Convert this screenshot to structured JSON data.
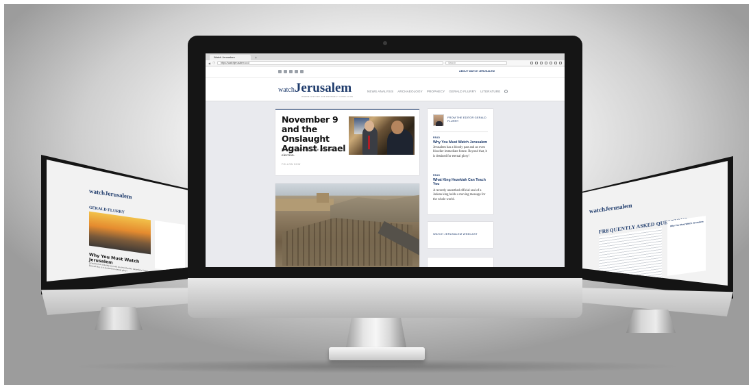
{
  "browser": {
    "tab_title": "Watch Jerusalem",
    "new_tab": "+",
    "url": "https://watchjerusalem.co.il",
    "search_placeholder": "Search"
  },
  "site": {
    "top_link": "ABOUT WATCH JERUSALEM",
    "logo_watch": "watch",
    "logo_jerusalem": "Jerusalem",
    "tagline": "WHERE HISTORY AND PROPHECY COME ALIVE",
    "nav": [
      "NEWS ANALYSIS",
      "ARCHAEOLOGY",
      "PROPHECY",
      "GERALD FLURRY",
      "LITERATURE"
    ]
  },
  "feature": {
    "title": "November 9 and the Onslaught Against Israel",
    "subtitle": "Israel prepares for battle after the U.S. election.",
    "follow": "FOLLOW NOW"
  },
  "sidebar": {
    "editor_label": "FROM THE EDITOR GERALD FLURRY",
    "articles": [
      {
        "tag": "READ",
        "title": "Why You Must Watch Jerusalem",
        "text": "Jerusalem has a bloody past and an even bloodier immediate future. Beyond that, it is destined for eternal glory!"
      },
      {
        "tag": "READ",
        "title": "What King Hezekiah Can Teach You",
        "text": "A recently unearthed official seal of a Judean king holds a moving message for the whole world."
      }
    ],
    "webcast": "WATCH JERUSALEM WEBCAST"
  },
  "left_screen": {
    "logo": "watchJerusalem",
    "section": "GERALD FLURRY",
    "headline": "Why You Must Watch Jerusalem",
    "text": "Jerusalem has a bloody past and an even bloodier immediate future. Beyond that, it is destined for eternal glory!"
  },
  "right_screen": {
    "logo": "watchJerusalem",
    "title": "FREQUENTLY ASKED QUESTIONS",
    "side_heading": "Why You Must Watch Jerusalem"
  },
  "colors": {
    "brand_navy": "#1d3a6b",
    "background": "#e9eaee"
  }
}
